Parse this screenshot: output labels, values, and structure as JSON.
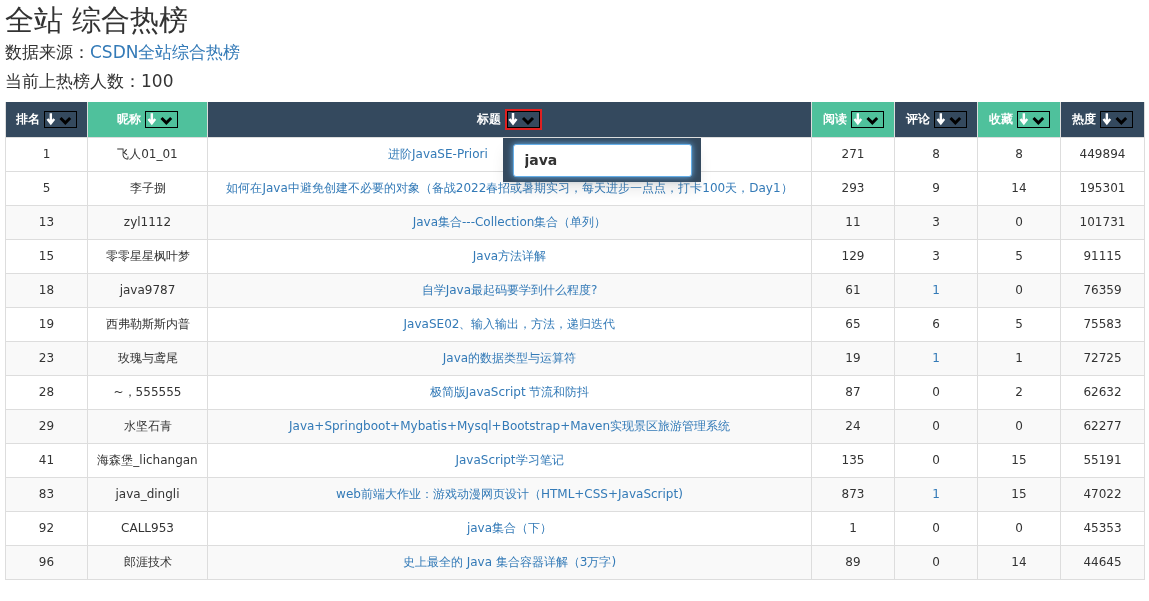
{
  "heading": "全站 综合热榜",
  "source": {
    "label": "数据来源：",
    "link": "CSDN全站综合热榜"
  },
  "count_line": "当前上热榜人数：100",
  "table": {
    "columns": [
      {
        "label": "排名",
        "color": "#34495e",
        "filter_active": false
      },
      {
        "label": "昵称",
        "color": "#4fc19c",
        "filter_active": false
      },
      {
        "label": "标题",
        "color": "#34495e",
        "filter_active": true
      },
      {
        "label": "阅读",
        "color": "#4fc19c",
        "filter_active": false
      },
      {
        "label": "评论",
        "color": "#34495e",
        "filter_active": false
      },
      {
        "label": "收藏",
        "color": "#4fc19c",
        "filter_active": false
      },
      {
        "label": "热度",
        "color": "#34495e",
        "filter_active": false
      }
    ],
    "rows": [
      {
        "rank": "1",
        "nickname": "飞人01_01",
        "title": "进阶JavaSE-Priori",
        "title_covered": true,
        "reads": "271",
        "comments": "8",
        "comments_link": false,
        "favorites": "8",
        "heat": "449894"
      },
      {
        "rank": "5",
        "nickname": "李子捌",
        "title": "如何在Java中避免创建不必要的对象（备战2022春招或暑期实习，每天进步一点点，打卡100天，Day1）",
        "title_covered": false,
        "reads": "293",
        "comments": "9",
        "comments_link": false,
        "favorites": "14",
        "heat": "195301"
      },
      {
        "rank": "13",
        "nickname": "zyl1112",
        "title": "Java集合---Collection集合（单列）",
        "title_covered": false,
        "reads": "11",
        "comments": "3",
        "comments_link": false,
        "favorites": "0",
        "heat": "101731"
      },
      {
        "rank": "15",
        "nickname": "零零星星枫叶梦",
        "title": "Java方法详解",
        "title_covered": false,
        "reads": "129",
        "comments": "3",
        "comments_link": false,
        "favorites": "5",
        "heat": "91115"
      },
      {
        "rank": "18",
        "nickname": "java9787",
        "title": "自学Java最起码要学到什么程度?",
        "title_covered": false,
        "reads": "61",
        "comments": "1",
        "comments_link": true,
        "favorites": "0",
        "heat": "76359"
      },
      {
        "rank": "19",
        "nickname": "西弗勒斯斯内普",
        "title": "JavaSE02、输入输出，方法，递归迭代",
        "title_covered": false,
        "reads": "65",
        "comments": "6",
        "comments_link": false,
        "favorites": "5",
        "heat": "75583"
      },
      {
        "rank": "23",
        "nickname": "玫瑰与鸢尾",
        "title": "Java的数据类型与运算符",
        "title_covered": false,
        "reads": "19",
        "comments": "1",
        "comments_link": true,
        "favorites": "1",
        "heat": "72725"
      },
      {
        "rank": "28",
        "nickname": "~，555555",
        "title": "极简版JavaScript 节流和防抖",
        "title_covered": false,
        "reads": "87",
        "comments": "0",
        "comments_link": false,
        "favorites": "2",
        "heat": "62632"
      },
      {
        "rank": "29",
        "nickname": "水坚石青",
        "title": "Java+Springboot+Mybatis+Mysql+Bootstrap+Maven实现景区旅游管理系统",
        "title_covered": false,
        "reads": "24",
        "comments": "0",
        "comments_link": false,
        "favorites": "0",
        "heat": "62277"
      },
      {
        "rank": "41",
        "nickname": "海森堡_lichangan",
        "title": "JavaScript学习笔记",
        "title_covered": false,
        "reads": "135",
        "comments": "0",
        "comments_link": false,
        "favorites": "15",
        "heat": "55191"
      },
      {
        "rank": "83",
        "nickname": "java_dingli",
        "title": "web前端大作业：游戏动漫网页设计（HTML+CSS+JavaScript)",
        "title_covered": false,
        "reads": "873",
        "comments": "1",
        "comments_link": true,
        "favorites": "15",
        "heat": "47022"
      },
      {
        "rank": "92",
        "nickname": "CALL953",
        "title": "java集合（下）",
        "title_covered": false,
        "reads": "1",
        "comments": "0",
        "comments_link": false,
        "favorites": "0",
        "heat": "45353"
      },
      {
        "rank": "96",
        "nickname": "郎涯技术",
        "title": "史上最全的 Java 集合容器详解（3万字)",
        "title_covered": false,
        "reads": "89",
        "comments": "0",
        "comments_link": false,
        "favorites": "14",
        "heat": "44645"
      }
    ]
  },
  "filter_popup": {
    "value": "java"
  }
}
